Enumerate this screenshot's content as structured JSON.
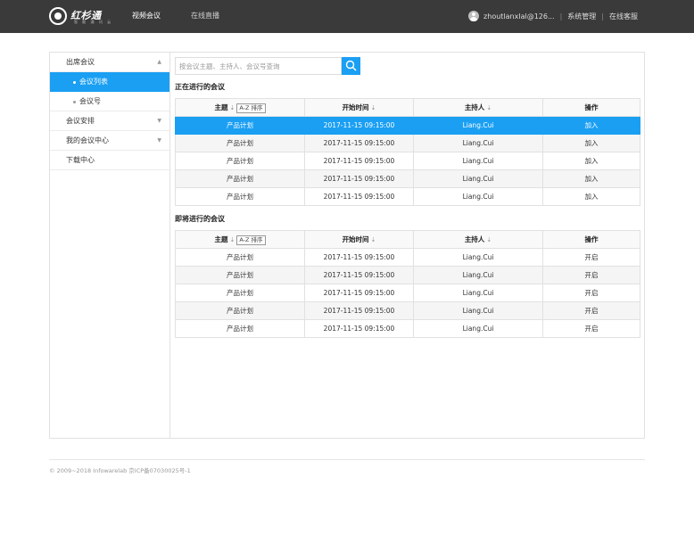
{
  "header": {
    "logo_text": "红杉通",
    "logo_sub": "智 能 通 讯 云",
    "nav": [
      "视频会议",
      "在线直播"
    ],
    "user": "zhoutlanxlal@126...",
    "links": [
      "系统管理",
      "在线客服"
    ]
  },
  "sidebar": {
    "items": [
      {
        "label": "出席会议",
        "chevron": "up"
      },
      {
        "label": "会议列表",
        "active": true
      },
      {
        "label": "会议号"
      },
      {
        "label": "会议安排",
        "chevron": "down"
      },
      {
        "label": "我的会议中心",
        "chevron": "down"
      },
      {
        "label": "下载中心"
      }
    ]
  },
  "search": {
    "placeholder": "按会议主题、主持人、会议号查询"
  },
  "ongoing": {
    "title": "正在进行的会议",
    "headers": {
      "topic": "主题",
      "az": "A-Z 排序",
      "time": "开始时间",
      "host": "主持人",
      "op": "操作"
    },
    "rows": [
      {
        "topic": "产品计划",
        "time": "2017-11-15 09:15:00",
        "host": "Liang.Cui",
        "op": "加入"
      },
      {
        "topic": "产品计划",
        "time": "2017-11-15 09:15:00",
        "host": "Liang.Cui",
        "op": "加入"
      },
      {
        "topic": "产品计划",
        "time": "2017-11-15 09:15:00",
        "host": "Liang.Cui",
        "op": "加入"
      },
      {
        "topic": "产品计划",
        "time": "2017-11-15 09:15:00",
        "host": "Liang.Cui",
        "op": "加入"
      },
      {
        "topic": "产品计划",
        "time": "2017-11-15 09:15:00",
        "host": "Liang.Cui",
        "op": "加入"
      }
    ]
  },
  "upcoming": {
    "title": "即将进行的会议",
    "headers": {
      "topic": "主题",
      "az": "A-Z 排序",
      "time": "开始时间",
      "host": "主持人",
      "op": "操作"
    },
    "rows": [
      {
        "topic": "产品计划",
        "time": "2017-11-15 09:15:00",
        "host": "Liang.Cui",
        "op": "开启"
      },
      {
        "topic": "产品计划",
        "time": "2017-11-15 09:15:00",
        "host": "Liang.Cui",
        "op": "开启"
      },
      {
        "topic": "产品计划",
        "time": "2017-11-15 09:15:00",
        "host": "Liang.Cui",
        "op": "开启"
      },
      {
        "topic": "产品计划",
        "time": "2017-11-15 09:15:00",
        "host": "Liang.Cui",
        "op": "开启"
      },
      {
        "topic": "产品计划",
        "time": "2017-11-15 09:15:00",
        "host": "Liang.Cui",
        "op": "开启"
      }
    ]
  },
  "footer": {
    "text": "© 2009~2018 Infowarelab 京ICP备07030025号-1"
  },
  "colors": {
    "accent": "#1a9ff3",
    "topbar": "#3a3a3a"
  },
  "icons": {
    "search": "search-icon",
    "avatar": "avatar-icon",
    "logo": "logo-icon"
  }
}
